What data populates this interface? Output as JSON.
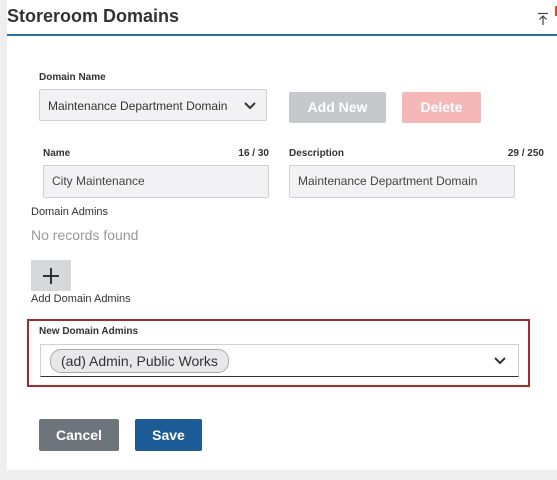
{
  "header": {
    "title": "Storeroom Domains"
  },
  "domain_name": {
    "label": "Domain Name",
    "selected": "Maintenance Department Domain"
  },
  "actions": {
    "add_new": "Add New",
    "delete": "Delete"
  },
  "name_field": {
    "label": "Name",
    "counter": "16 / 30",
    "value": "City Maintenance"
  },
  "description_field": {
    "label": "Description",
    "counter": "29 / 250",
    "value": "Maintenance Department Domain"
  },
  "domain_admins": {
    "label": "Domain Admins",
    "empty_text": "No records found",
    "add_label": "Add Domain Admins"
  },
  "new_domain_admins": {
    "label": "New Domain Admins",
    "chips": [
      "(ad) Admin, Public Works"
    ]
  },
  "footer": {
    "cancel": "Cancel",
    "save": "Save"
  },
  "colors": {
    "accent": "#2e6da4",
    "save": "#1b5c97",
    "cancel": "#6e747c",
    "delete_disabled": "#f5b8b8",
    "highlight_border": "#a52a2a"
  },
  "icons": {
    "collapse": "collapse-up-icon",
    "select_arrow": "chevron-down-icon",
    "add": "plus-icon"
  }
}
